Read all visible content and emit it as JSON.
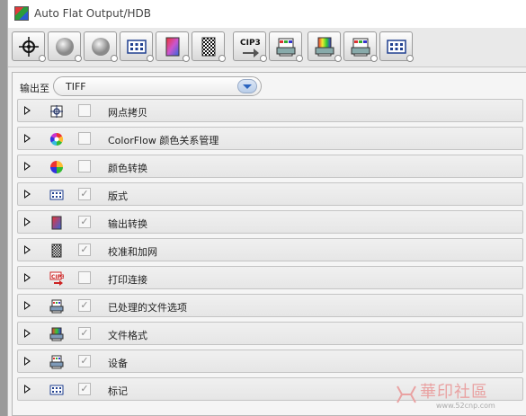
{
  "window": {
    "title": "Auto Flat Output/HDB"
  },
  "toolbar": {
    "buttons": [
      {
        "name": "screening-copy-button",
        "icon": "target-crosshair-icon"
      },
      {
        "name": "gray-circle-button-1",
        "icon": "gray-sphere-icon"
      },
      {
        "name": "gray-circle-button-2",
        "icon": "gray-sphere-icon"
      },
      {
        "name": "layout-grid-button",
        "icon": "grid-icon"
      },
      {
        "name": "output-convert-button",
        "icon": "gradient-page-icon"
      },
      {
        "name": "calibrate-screen-button",
        "icon": "checker-page-icon"
      },
      {
        "name": "cip3-button",
        "icon": "cip3-icon",
        "label": "CIP 3"
      },
      {
        "name": "printer-button-1",
        "icon": "printer-icon"
      },
      {
        "name": "printer-button-2",
        "icon": "printer-color-icon"
      },
      {
        "name": "printer-button-3",
        "icon": "printer-icon"
      },
      {
        "name": "grid-button-2",
        "icon": "grid-icon"
      }
    ]
  },
  "output": {
    "label": "输出至",
    "value": "TIFF"
  },
  "rows": [
    {
      "label": "网点拷贝",
      "icon": "target-icon",
      "checked": false
    },
    {
      "label": "ColorFlow 颜色关系管理",
      "icon": "color-wheel-icon",
      "checked": false
    },
    {
      "label": "颜色转换",
      "icon": "color-convert-icon",
      "checked": false
    },
    {
      "label": "版式",
      "icon": "grid-icon",
      "checked": true
    },
    {
      "label": "输出转换",
      "icon": "gradient-page-icon",
      "checked": true
    },
    {
      "label": "校准和加网",
      "icon": "checker-icon",
      "checked": true
    },
    {
      "label": "打印连接",
      "icon": "cip3-icon",
      "checked": false
    },
    {
      "label": "已处理的文件选项",
      "icon": "printer-icon",
      "checked": true
    },
    {
      "label": "文件格式",
      "icon": "printer-color-icon",
      "checked": true
    },
    {
      "label": "设备",
      "icon": "printer-icon",
      "checked": true
    },
    {
      "label": "标记",
      "icon": "grid-icon",
      "checked": true
    }
  ],
  "watermark": {
    "text": "華印社區",
    "url": "www.52cnp.com"
  },
  "colors": {
    "accent": "#2a64bf",
    "panel": "#f5f5f5"
  }
}
